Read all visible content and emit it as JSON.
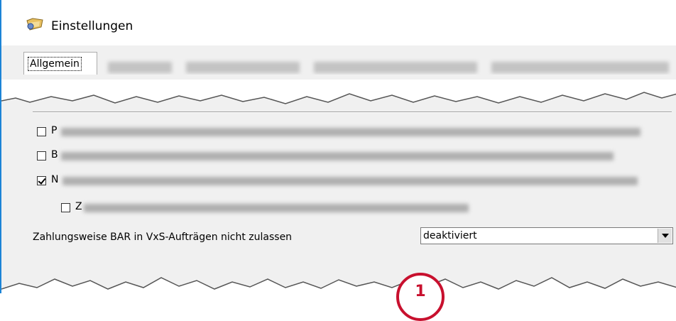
{
  "window": {
    "title": "Einstellungen",
    "title_icon": "settings-folder-icon",
    "accent_color": "#1c84d6"
  },
  "tabs": {
    "active_label": "Allgemein"
  },
  "options": [
    {
      "visible_letter": "P",
      "checked": false
    },
    {
      "visible_letter": "B",
      "checked": false
    },
    {
      "visible_letter": "N",
      "checked": true
    },
    {
      "visible_letter": "Z",
      "checked": false
    }
  ],
  "setting": {
    "label": "Zahlungsweise BAR in VxS-Aufträgen nicht zulassen",
    "value": "deaktiviert"
  },
  "marker": {
    "label": "1",
    "color": "#c8102e"
  }
}
